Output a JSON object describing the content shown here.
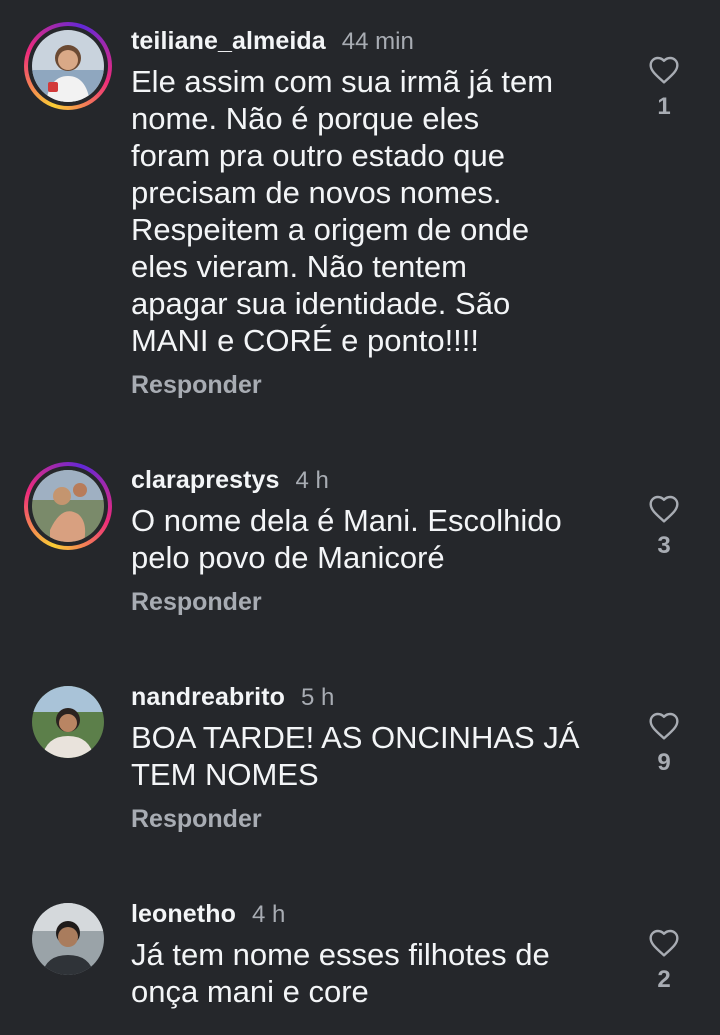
{
  "comments": [
    {
      "username": "teiliane_almeida",
      "time": "44 min",
      "text": "Ele assim com sua irmã já tem\nnome. Não é porque eles\nforam pra outro estado que\nprecisam de novos nomes.\nRespeitem a origem de onde\neles vieram. Não tentem\napagar sua identidade. São\nMANI e CORÉ e ponto!!!!",
      "reply_label": "Responder",
      "likes": "1",
      "has_story": true
    },
    {
      "username": "claraprestys",
      "time": "4 h",
      "text": "O nome dela é Mani. Escolhido\npelo povo de Manicoré",
      "reply_label": "Responder",
      "likes": "3",
      "has_story": true
    },
    {
      "username": "nandreabrito",
      "time": "5 h",
      "text": "BOA TARDE! AS ONCINHAS JÁ\nTEM NOMES",
      "reply_label": "Responder",
      "likes": "9",
      "has_story": false
    },
    {
      "username": "leonetho",
      "time": "4 h",
      "text": "Já tem nome esses filhotes de\nonça mani e core",
      "reply_label": "",
      "likes": "2",
      "has_story": false
    }
  ],
  "icons": {
    "like": "heart-outline-icon"
  },
  "colors": {
    "background": "#25272b",
    "primary_text": "#f3f5f7",
    "secondary_text": "#a8acb3"
  }
}
